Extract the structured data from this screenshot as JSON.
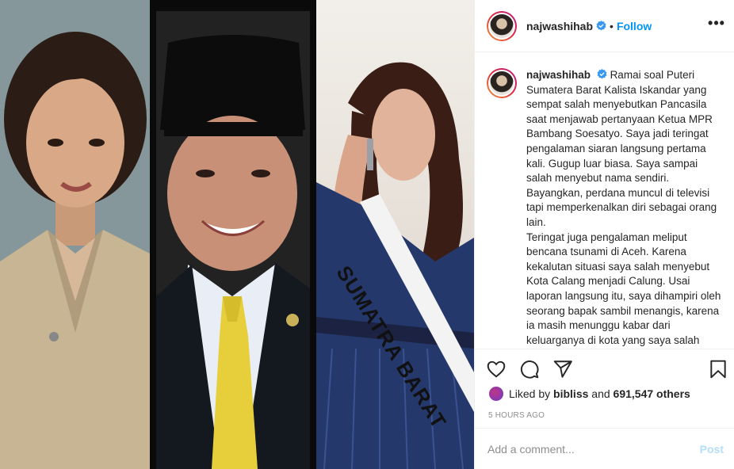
{
  "header": {
    "username": "najwashihab",
    "separator": "•",
    "follow_label": "Follow",
    "more_label": "•••"
  },
  "caption": {
    "username": "najwashihab",
    "para1": "Ramai soal Puteri Sumatera Barat Kalista Iskandar yang sempat salah menyebutkan Pancasila saat menjawab pertanyaan Ketua MPR Bambang Soesatyo. Saya jadi teringat pengalaman siaran langsung pertama kali. Gugup luar biasa. Saya sampai salah menyebut nama sendiri. Bayangkan, perdana muncul di televisi tapi memperkenalkan diri sebagai orang lain.",
    "para2": "Teringat juga pengalaman meliput bencana tsunami di Aceh. Karena kekalutan situasi saya salah menyebut Kota Calang menjadi Calung. Usai laporan langsung itu, saya dihampiri oleh seorang bapak sambil menangis, karena ia masih menunggu kabar dari keluarganya di kota yang saya salah"
  },
  "media": {
    "sash_text": "SUMATRA BARAT"
  },
  "likes": {
    "prefix": "Liked by",
    "user": "bibliss",
    "middle": "and",
    "count": "691,547 others"
  },
  "timestamp": "5 HOURS AGO",
  "comment_box": {
    "placeholder": "Add a comment...",
    "post_label": "Post"
  },
  "colors": {
    "accent_blue": "#0095f6",
    "post_disabled": "#b2dffc",
    "verified": "#3897f0",
    "muted": "#8e8e8e"
  },
  "icons": [
    "heart-icon",
    "comment-icon",
    "share-icon",
    "bookmark-icon",
    "verified-badge-icon",
    "more-icon"
  ]
}
